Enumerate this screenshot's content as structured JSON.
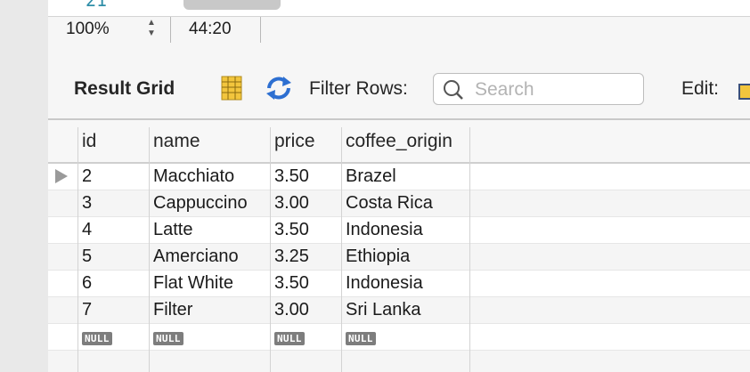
{
  "editor": {
    "line_number": "21"
  },
  "status": {
    "zoom": "100%",
    "cursor_position": "44:20"
  },
  "toolbar": {
    "result_grid_label": "Result Grid",
    "filter_label": "Filter Rows:",
    "search_placeholder": "Search",
    "edit_label": "Edit:"
  },
  "grid": {
    "columns": [
      "id",
      "name",
      "price",
      "coffee_origin"
    ],
    "rows": [
      [
        "2",
        "Macchiato",
        "3.50",
        "Brazel"
      ],
      [
        "3",
        "Cappuccino",
        "3.00",
        "Costa Rica"
      ],
      [
        "4",
        "Latte",
        "3.50",
        "Indonesia"
      ],
      [
        "5",
        "Amerciano",
        "3.25",
        "Ethiopia"
      ],
      [
        "6",
        "Flat White",
        "3.50",
        "Indonesia"
      ],
      [
        "7",
        "Filter",
        "3.00",
        "Sri Lanka"
      ]
    ],
    "null_label": "NULL"
  },
  "icons": {
    "grid": "grid-layout-icon",
    "refresh": "refresh-icon",
    "search": "search-icon",
    "edit": "edit-icon",
    "row_pointer": "row-pointer-icon"
  },
  "colors": {
    "line_number": "#2f8ea8",
    "null_badge": "#7d7d7d",
    "grid_icon": "#f2c53d",
    "refresh_icon": "#2d6fd1"
  }
}
